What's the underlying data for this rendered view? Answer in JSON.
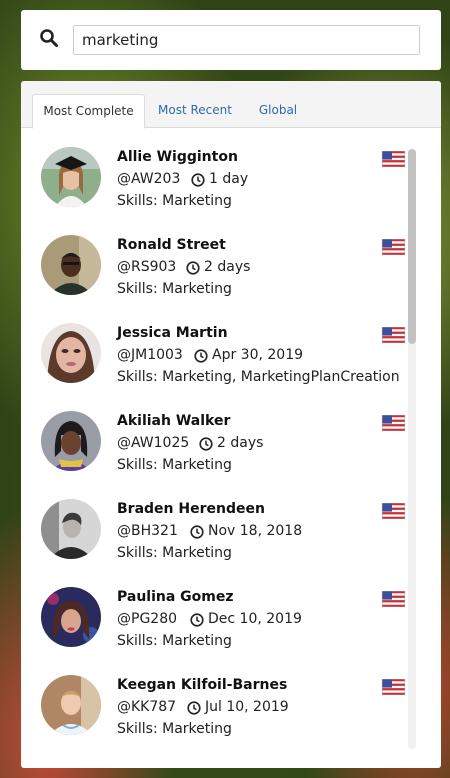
{
  "search": {
    "value": "marketing"
  },
  "tabs": [
    {
      "label": "Most Complete",
      "active": true
    },
    {
      "label": "Most Recent",
      "active": false
    },
    {
      "label": "Global",
      "active": false
    }
  ],
  "users": [
    {
      "name": "Allie Wigginton",
      "handle": "@AW203",
      "time": "1 day",
      "skills": "Skills: Marketing",
      "country_flag": "us-flag-icon"
    },
    {
      "name": "Ronald Street",
      "handle": "@RS903",
      "time": "2 days",
      "skills": "Skills: Marketing",
      "country_flag": "us-flag-icon"
    },
    {
      "name": "Jessica Martin",
      "handle": "@JM1003",
      "time": "Apr 30, 2019",
      "skills": "Skills: Marketing, MarketingPlanCreation",
      "country_flag": "us-flag-icon"
    },
    {
      "name": "Akiliah Walker",
      "handle": "@AW1025",
      "time": "2 days",
      "skills": "Skills: Marketing",
      "country_flag": "us-flag-icon"
    },
    {
      "name": "Braden Herendeen",
      "handle": "@BH321",
      "time": "Nov 18, 2018",
      "skills": "Skills: Marketing",
      "country_flag": "us-flag-icon"
    },
    {
      "name": "Paulina Gomez",
      "handle": "@PG280",
      "time": "Dec 10, 2019",
      "skills": "Skills: Marketing",
      "country_flag": "us-flag-icon"
    },
    {
      "name": "Keegan Kilfoil-Barnes",
      "handle": "@KK787",
      "time": "Jul 10, 2019",
      "skills": "Skills: Marketing",
      "country_flag": "us-flag-icon"
    }
  ]
}
